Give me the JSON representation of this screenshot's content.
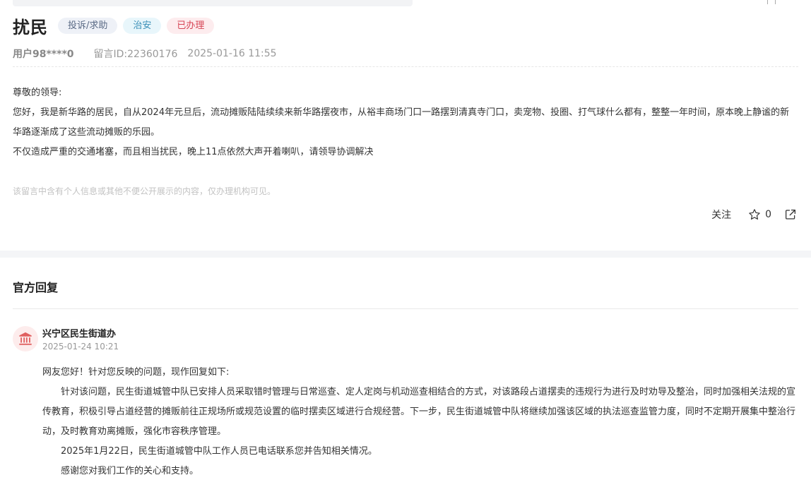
{
  "post": {
    "title": "扰民",
    "tags": {
      "type": "投诉/求助",
      "category": "治安",
      "status": "已办理"
    },
    "user": "用户98****0",
    "message_id": "留言ID:22360176",
    "datetime": "2025-01-16 11:55",
    "content": [
      "尊敬的领导:",
      "您好，我是新华路的居民，自从2024年元旦后，流动摊贩陆陆续续来新华路摆夜市，从裕丰商场门口一路摆到清真寺门口，卖宠物、投圈、打气球什么都有，整整一年时间，原本晚上静谧的新华路逐渐成了这些流动摊贩的乐园。",
      "不仅造成严重的交通堵塞，而且相当扰民，晚上11点依然大声开着喇叭，请领导协调解决"
    ],
    "privacy_note": "该留言中含有个人信息或其他不便公开展示的内容，仅办理机构可见。",
    "actions": {
      "follow_label": "关注",
      "like_count": "0"
    }
  },
  "reply": {
    "heading": "官方回复",
    "org_name": "兴宁区民生街道办",
    "time": "2025-01-24 10:21",
    "paragraphs": [
      "网友您好！针对您反映的问题，现作回复如下:",
      "针对该问题，民生街道城管中队已安排人员采取错时管理与日常巡查、定人定岗与机动巡查相结合的方式，对该路段占道摆卖的违规行为进行及时劝导及整治，同时加强相关法规的宣传教育，积极引导占道经营的摊贩前往正规场所或规范设置的临时摆卖区域进行合规经营。下一步，民生街道城管中队将继续加强该区域的执法巡查监管力度，同时不定期开展集中整治行动，及时教育劝离摊贩，强化市容秩序管理。",
      "2025年1月22日，民生街道城管中队工作人员已电话联系您并告知相关情况。",
      "感谢您对我们工作的关心和支持。"
    ]
  },
  "icons": {
    "star": "star-icon",
    "share": "share-icon",
    "avatar": "government-building-icon"
  },
  "colors": {
    "status_tag": "#d64555",
    "category_tag": "#3a8fb7",
    "avatar_bg": "#fdecec",
    "avatar_icon": "#e06060"
  }
}
